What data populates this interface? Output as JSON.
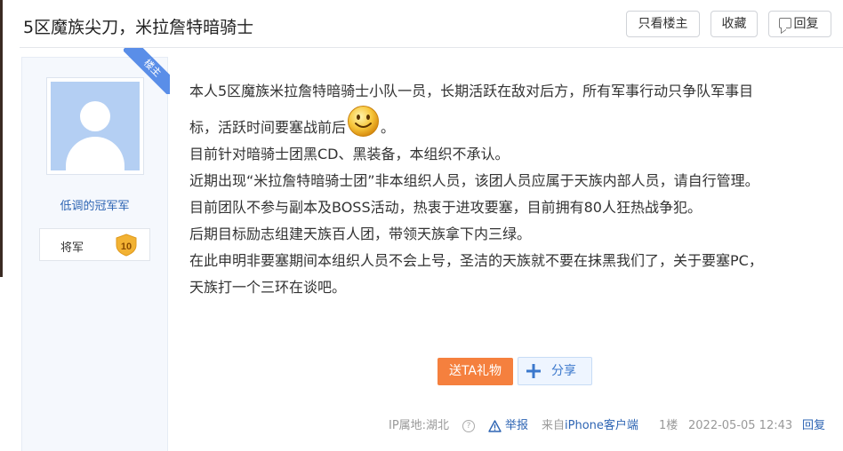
{
  "thread": {
    "title": "5区魔族尖刀，米拉詹特暗骑士",
    "buttons": {
      "only_op": "只看楼主",
      "favorite": "收藏",
      "reply": "回复"
    }
  },
  "author": {
    "badge": "楼主",
    "name": "低调的冠军军",
    "level_title": "将军",
    "level_number": "10"
  },
  "post": {
    "line1": "本人5区魔族米拉詹特暗骑士小队一员，长期活跃在敌对后方，所有军事行动只争队军事目",
    "line2_before": "标，活跃时间要塞战前后",
    "line2_after": "。",
    "lines": [
      "目前针对暗骑士团黑CD、黑装备，本组织不承认。",
      "近期出现“米拉詹特暗骑士团”非本组织人员，该团人员应属于天族内部人员，请自行管理。",
      "目前团队不参与副本及BOSS活动，热衷于进攻要塞，目前拥有80人狂热战争犯。",
      "后期目标励志组建天族百人团，带领天族拿下内三绿。",
      "在此申明非要塞期间本组织人员不会上号，圣洁的天族就不要在抹黑我们了，关于要塞PC，",
      "天族打一个三环在谈吧。"
    ]
  },
  "actions": {
    "gift": "送TA礼物",
    "share": "分享"
  },
  "footer": {
    "ip": "IP属地:湖北",
    "help": "?",
    "report": "举报",
    "source_prefix": "来自",
    "source_device": "iPhone客户端",
    "floor": "1楼",
    "time": "2022-05-05 12:43",
    "reply": "回复"
  },
  "icons": {
    "smiley": "smiley-emoticon-icon",
    "share": "plus-share-icon",
    "report": "warning-triangle-icon",
    "reply": "speech-bubble-icon",
    "help": "question-circle-icon"
  },
  "colors": {
    "accent_blue": "#2d64b3",
    "gift_orange": "#f5803e",
    "badge_blue": "#5a8ee8",
    "level_gold": "#f2b233"
  }
}
